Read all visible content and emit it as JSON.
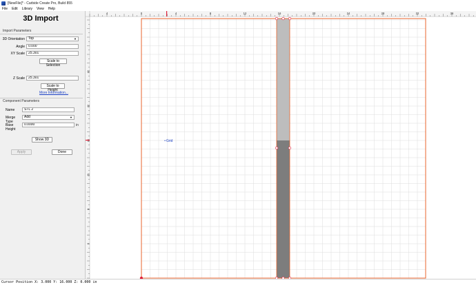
{
  "window": {
    "title": "[NewFile]* - Carbide Create Pro, Build 855"
  },
  "menu": {
    "items": [
      "File",
      "Edit",
      "Library",
      "View",
      "Help"
    ]
  },
  "panel": {
    "title": "3D Import",
    "import_section": "Import Parameters",
    "orientation_label": "3D Orientation",
    "orientation_value": "Top",
    "angle_label": "Angle",
    "angle_value": "0.000",
    "xy_scale_label": "XY Scale",
    "xy_scale_value": "25.301",
    "scale_to_selection": "Scale to Selection",
    "z_scale_label": "Z Scale",
    "z_scale_value": "25.301",
    "scale_to_height": "Scale to Height",
    "more_info": "More Information...",
    "component_section": "Component Parameters",
    "name_label": "Name",
    "name_value": "STL 2",
    "merge_label": "Merge Type",
    "merge_value": "Add",
    "base_label": "Base Height",
    "base_value": "0.0000",
    "base_unit": "in",
    "show3d": "Show 3D",
    "apply": "Apply",
    "done": "Done"
  },
  "canvas": {
    "top_ruler_labels": [
      "4",
      "0",
      "4",
      "8",
      "12",
      "16",
      "20",
      "24",
      "28",
      "32",
      "36"
    ],
    "left_ruler_labels": [
      "24",
      "20",
      "16",
      "12",
      "8",
      "4"
    ],
    "grid_label": "Grid",
    "colors": {
      "border": "#e8632b",
      "grid": "#d9d9d9",
      "part_light": "#bdbdbd",
      "part_dark": "#7d7d7d",
      "marker": "#e0203a"
    }
  },
  "status": {
    "cursor": "Cursor Position X: 3.000 Y: 16.000 Z: 0.000 in"
  }
}
